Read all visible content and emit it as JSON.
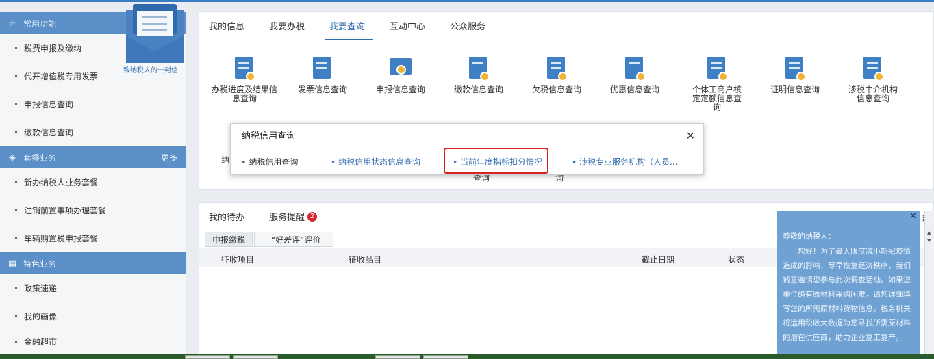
{
  "sidebar": {
    "sections": [
      {
        "title": "常用功能",
        "icon": "star-icon",
        "more": "",
        "items": [
          "税费申报及缴纳",
          "代开增值税专用发票",
          "申报信息查询",
          "缴款信息查询"
        ]
      },
      {
        "title": "套餐业务",
        "icon": "layers-icon",
        "more": "更多",
        "items": [
          "新办纳税人业务套餐",
          "注销前置事项办理套餐",
          "车辆购置税申报套餐"
        ]
      },
      {
        "title": "特色业务",
        "icon": "grid-icon",
        "more": "",
        "items": [
          "政策速递",
          "我的画像",
          "金融超市"
        ]
      }
    ]
  },
  "letter": {
    "caption": "致纳税人的一封信"
  },
  "main": {
    "tabs": [
      "我的信息",
      "我要办税",
      "我要查询",
      "互动中心",
      "公众服务"
    ],
    "active_tab": "我要查询",
    "query_items": [
      {
        "label": "办税进度及结果信息查询",
        "icon": "progress-doc-icon"
      },
      {
        "label": "发票信息查询",
        "icon": "invoice-icon"
      },
      {
        "label": "申报信息查询",
        "icon": "monitor-search-icon"
      },
      {
        "label": "缴款信息查询",
        "icon": "payment-icon"
      },
      {
        "label": "欠税信息查询",
        "icon": "arrears-icon"
      },
      {
        "label": "优惠信息查询",
        "icon": "discount-icon"
      },
      {
        "label": "个体工商户核定定额信息查询",
        "icon": "individual-business-icon"
      },
      {
        "label": "证明信息查询",
        "icon": "certificate-icon"
      },
      {
        "label": "涉税中介机构信息查询",
        "icon": "agency-icon"
      }
    ],
    "row2_partial": [
      "纳",
      "查询",
      "询"
    ]
  },
  "bottom": {
    "tabs": [
      "我的待办",
      "服务提醒"
    ],
    "reminder_count": "2",
    "subtabs": [
      "申报缴税",
      "“好差评”评价"
    ],
    "columns": [
      "征收项目",
      "征收品目",
      "截止日期",
      "状态"
    ],
    "refresh_label": "新"
  },
  "modal": {
    "title": "纳税信用查询",
    "links": [
      "纳税信用查询",
      "纳税信用状态信息查询",
      "当前年度指标扣分情况",
      "涉税专业服务机构（人员..."
    ],
    "highlighted": "当前年度指标扣分情况"
  },
  "notice": {
    "salutation": "尊敬的纳税人：",
    "body": "您好！为了最大限度减小新冠疫情造成的影响，尽早恢复经济秩序，我们诚意邀请您参与此次调查活动。如果您单位确有原材料采购困难，请您详细填写您的所需原材料货物信息，税务机关将运用税收大数据为您寻找所需原材料的潜在供应商，助力企业复工复产。"
  },
  "colors": {
    "accent": "#2f6aad",
    "sidebar_header": "#5b8fc7",
    "highlight_border": "#e0201e",
    "notice_bg": "#6fa2d3"
  }
}
